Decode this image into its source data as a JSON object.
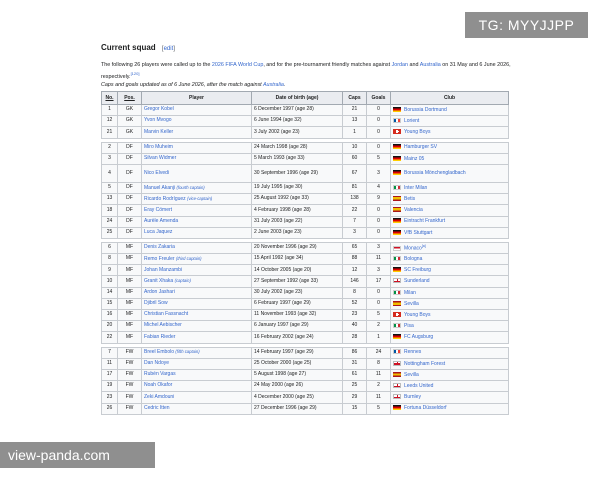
{
  "watermarks": {
    "top": "TG: MYYJJPP",
    "bottom": "view-panda.com"
  },
  "section": {
    "title": "Current squad",
    "edit_open": "[",
    "edit_label": "edit",
    "edit_close": "]"
  },
  "intro": {
    "t1": "The following 26 players were called up to the ",
    "l1": "2026 FIFA World Cup",
    "t2": ", and for the pre-tournament friendly matches against ",
    "l2": "Jordan",
    "t3": " and ",
    "l3": "Australia",
    "t4": " on 31 May and 6 June 2026, respectively.",
    "ref": "[120]",
    "note_t1": "Caps and goals updated as of 6 June 2026, after the match against ",
    "note_l1": "Australia",
    "note_t2": "."
  },
  "table": {
    "headers": {
      "no": "No.",
      "pos": "Pos.",
      "player": "Player",
      "dob": "Date of birth (age)",
      "caps": "Caps",
      "goals": "Goals",
      "club": "Club"
    },
    "groups": [
      [
        {
          "no": "1",
          "pos": "GK",
          "player": "Gregor Kobel",
          "role": "",
          "dob": "6 December 1997 (age 28)",
          "caps": "21",
          "goals": "0",
          "flag": "de",
          "club": "Borussia Dortmund",
          "sup": ""
        },
        {
          "no": "12",
          "pos": "GK",
          "player": "Yvon Mvogo",
          "role": "",
          "dob": "6 June 1994 (age 32)",
          "caps": "13",
          "goals": "0",
          "flag": "fr",
          "club": "Lorient",
          "sup": ""
        },
        {
          "no": "21",
          "pos": "GK",
          "player": "Marvin Keller",
          "role": "",
          "dob": "3 July 2002 (age 23)",
          "caps": "1",
          "goals": "0",
          "flag": "ch",
          "club": "Young Boys",
          "sup": ""
        }
      ],
      [
        {
          "no": "2",
          "pos": "DF",
          "player": "Miro Muheim",
          "role": "",
          "dob": "24 March 1998 (age 28)",
          "caps": "10",
          "goals": "0",
          "flag": "de",
          "club": "Hamburger SV",
          "sup": ""
        },
        {
          "no": "3",
          "pos": "DF",
          "player": "Silvan Widmer",
          "role": "",
          "dob": "5 March 1993 (age 33)",
          "caps": "60",
          "goals": "5",
          "flag": "de",
          "club": "Mainz 05",
          "sup": ""
        },
        {
          "no": "4",
          "pos": "DF",
          "player": "Nico Elvedi",
          "role": "",
          "dob": "30 September 1996 (age 29)",
          "caps": "67",
          "goals": "3",
          "flag": "de",
          "club": "Borussia Mönchengladbach",
          "sup": "",
          "tall": true
        },
        {
          "no": "5",
          "pos": "DF",
          "player": "Manuel Akanji",
          "role": "(fourth captain)",
          "dob": "19 July 1995 (age 30)",
          "caps": "81",
          "goals": "4",
          "flag": "it",
          "club": "Inter Milan",
          "sup": ""
        },
        {
          "no": "13",
          "pos": "DF",
          "player": "Ricardo Rodríguez",
          "role": "(vice-captain)",
          "dob": "25 August 1992 (age 33)",
          "caps": "138",
          "goals": "9",
          "flag": "es",
          "club": "Betis",
          "sup": ""
        },
        {
          "no": "18",
          "pos": "DF",
          "player": "Eray Cömert",
          "role": "",
          "dob": "4 February 1998 (age 28)",
          "caps": "22",
          "goals": "0",
          "flag": "es",
          "club": "Valencia",
          "sup": ""
        },
        {
          "no": "24",
          "pos": "DF",
          "player": "Aurèle Amenda",
          "role": "",
          "dob": "31 July 2003 (age 22)",
          "caps": "7",
          "goals": "0",
          "flag": "de",
          "club": "Eintracht Frankfurt",
          "sup": ""
        },
        {
          "no": "25",
          "pos": "DF",
          "player": "Luca Jaquez",
          "role": "",
          "dob": "2 June 2003 (age 23)",
          "caps": "3",
          "goals": "0",
          "flag": "de",
          "club": "VfB Stuttgart",
          "sup": ""
        }
      ],
      [
        {
          "no": "6",
          "pos": "MF",
          "player": "Denis Zakaria",
          "role": "",
          "dob": "20 November 1996 (age 29)",
          "caps": "65",
          "goals": "3",
          "flag": "mc",
          "club": "Monaco",
          "sup": "[a]"
        },
        {
          "no": "8",
          "pos": "MF",
          "player": "Remo Freuler",
          "role": "(third captain)",
          "dob": "15 April 1992 (age 34)",
          "caps": "88",
          "goals": "11",
          "flag": "it",
          "club": "Bologna",
          "sup": ""
        },
        {
          "no": "9",
          "pos": "MF",
          "player": "Johan Manzambi",
          "role": "",
          "dob": "14 October 2005 (age 20)",
          "caps": "12",
          "goals": "3",
          "flag": "de",
          "club": "SC Freiburg",
          "sup": ""
        },
        {
          "no": "10",
          "pos": "MF",
          "player": "Granit Xhaka",
          "role": "(captain)",
          "dob": "27 September 1992 (age 33)",
          "caps": "146",
          "goals": "17",
          "flag": "en",
          "club": "Sunderland",
          "sup": ""
        },
        {
          "no": "14",
          "pos": "MF",
          "player": "Ardon Jashari",
          "role": "",
          "dob": "30 July 2002 (age 23)",
          "caps": "8",
          "goals": "0",
          "flag": "it",
          "club": "Milan",
          "sup": ""
        },
        {
          "no": "15",
          "pos": "MF",
          "player": "Djibril Sow",
          "role": "",
          "dob": "6 February 1997 (age 29)",
          "caps": "52",
          "goals": "0",
          "flag": "es",
          "club": "Sevilla",
          "sup": ""
        },
        {
          "no": "16",
          "pos": "MF",
          "player": "Christian Fassnacht",
          "role": "",
          "dob": "11 November 1993 (age 32)",
          "caps": "23",
          "goals": "5",
          "flag": "ch",
          "club": "Young Boys",
          "sup": ""
        },
        {
          "no": "20",
          "pos": "MF",
          "player": "Michel Aebischer",
          "role": "",
          "dob": "6 January 1997 (age 29)",
          "caps": "40",
          "goals": "2",
          "flag": "it",
          "club": "Pisa",
          "sup": ""
        },
        {
          "no": "22",
          "pos": "MF",
          "player": "Fabian Rieder",
          "role": "",
          "dob": "16 February 2002 (age 24)",
          "caps": "28",
          "goals": "1",
          "flag": "de",
          "club": "FC Augsburg",
          "sup": ""
        }
      ],
      [
        {
          "no": "7",
          "pos": "FW",
          "player": "Breel Embolo",
          "role": "(fifth captain)",
          "dob": "14 February 1997 (age 29)",
          "caps": "86",
          "goals": "24",
          "flag": "fr",
          "club": "Rennes",
          "sup": ""
        },
        {
          "no": "11",
          "pos": "FW",
          "player": "Dan Ndoye",
          "role": "",
          "dob": "25 October 2000 (age 25)",
          "caps": "31",
          "goals": "8",
          "flag": "en",
          "club": "Nottingham Forest",
          "sup": ""
        },
        {
          "no": "17",
          "pos": "FW",
          "player": "Rubén Vargas",
          "role": "",
          "dob": "5 August 1998 (age 27)",
          "caps": "61",
          "goals": "11",
          "flag": "es",
          "club": "Sevilla",
          "sup": ""
        },
        {
          "no": "19",
          "pos": "FW",
          "player": "Noah Okafor",
          "role": "",
          "dob": "24 May 2000 (age 26)",
          "caps": "25",
          "goals": "2",
          "flag": "en",
          "club": "Leeds United",
          "sup": ""
        },
        {
          "no": "23",
          "pos": "FW",
          "player": "Zeki Amdouni",
          "role": "",
          "dob": "4 December 2000 (age 25)",
          "caps": "29",
          "goals": "11",
          "flag": "en",
          "club": "Burnley",
          "sup": ""
        },
        {
          "no": "26",
          "pos": "FW",
          "player": "Cedric Itten",
          "role": "",
          "dob": "27 December 1996 (age 29)",
          "caps": "15",
          "goals": "5",
          "flag": "de",
          "club": "Fortuna Düsseldorf",
          "sup": ""
        }
      ]
    ]
  }
}
